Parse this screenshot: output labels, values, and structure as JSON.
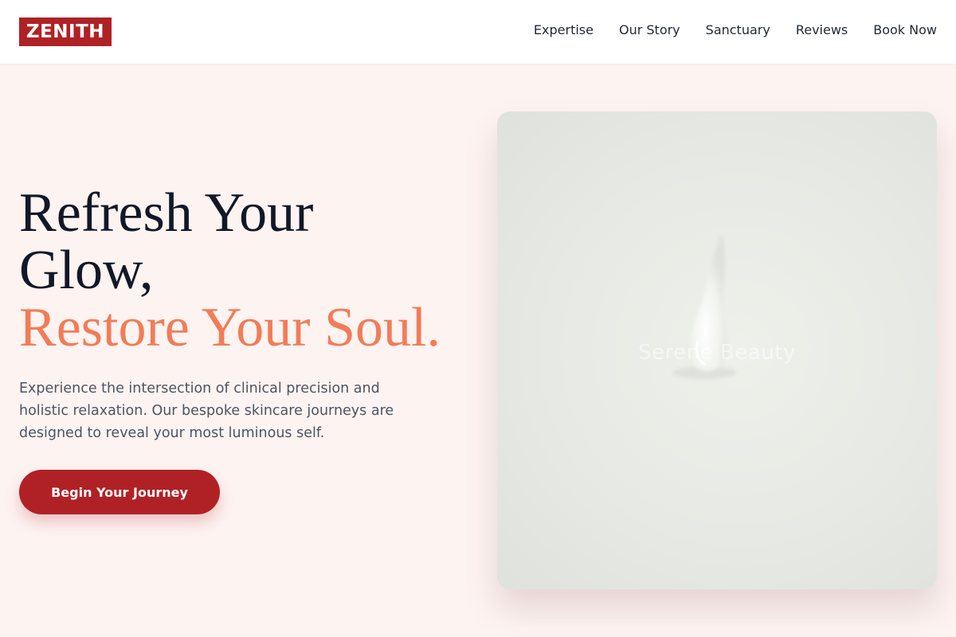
{
  "brand": {
    "logo_text": "ZENITH",
    "accent_color": "#b02125",
    "highlight_color": "#f27c58",
    "background_color": "#fdf3f1"
  },
  "nav": {
    "items": [
      {
        "label": "Expertise"
      },
      {
        "label": "Our Story"
      },
      {
        "label": "Sanctuary"
      },
      {
        "label": "Reviews"
      },
      {
        "label": "Book Now"
      }
    ]
  },
  "hero": {
    "headline_line1": "Refresh Your",
    "headline_line2": "Glow,",
    "headline_accent": "Restore Your Soul.",
    "description": "Experience the intersection of clinical precision and holistic relaxation. Our bespoke skincare journeys are designed to reveal your most luminous self.",
    "cta_label": "Begin Your Journey"
  },
  "image": {
    "overlay_text": "Serene Beauty",
    "icon": "serum-droplet-image"
  }
}
